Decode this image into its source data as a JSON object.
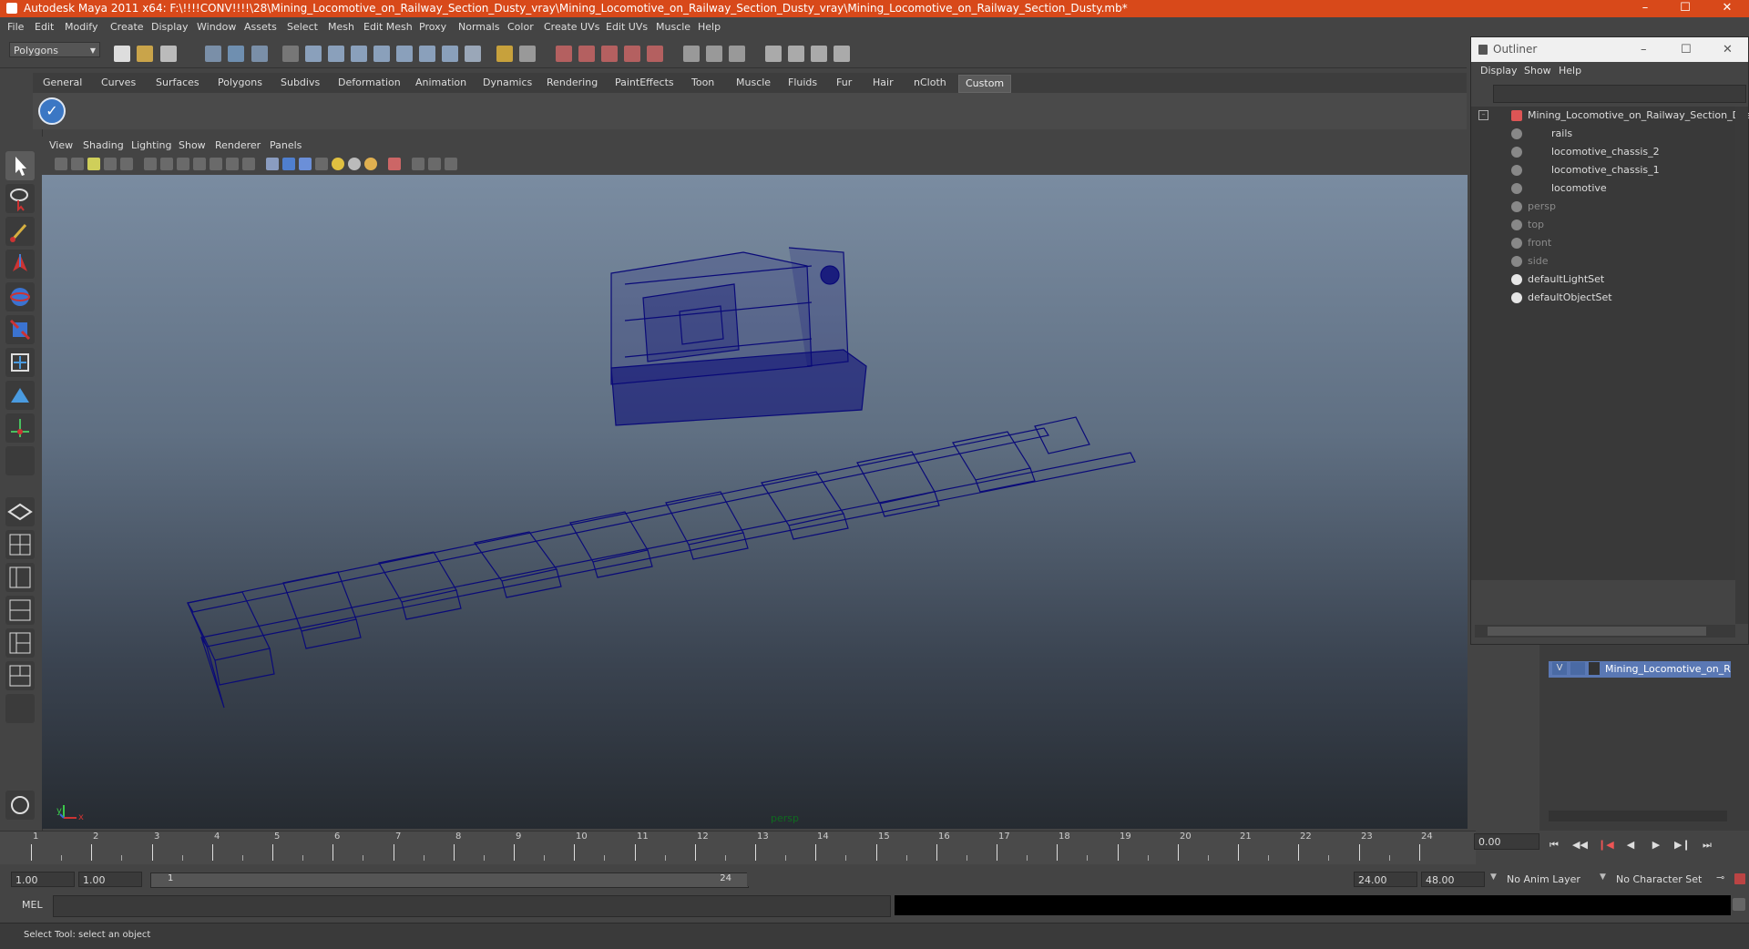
{
  "window": {
    "title": "Autodesk Maya 2011 x64: F:\\!!!!CONV!!!!\\28\\Mining_Locomotive_on_Railway_Section_Dusty_vray\\Mining_Locomotive_on_Railway_Section_Dusty_vray\\Mining_Locomotive_on_Railway_Section_Dusty.mb*"
  },
  "menubar": [
    "File",
    "Edit",
    "Modify",
    "Create",
    "Display",
    "Window",
    "Assets",
    "Select",
    "Mesh",
    "Edit Mesh",
    "Proxy",
    "Normals",
    "Color",
    "Create UVs",
    "Edit UVs",
    "Muscle",
    "Help"
  ],
  "status_line": {
    "mode": "Polygons"
  },
  "shelf_tabs": [
    {
      "label": "General"
    },
    {
      "label": "Curves"
    },
    {
      "label": "Surfaces"
    },
    {
      "label": "Polygons"
    },
    {
      "label": "Subdivs"
    },
    {
      "label": "Deformation"
    },
    {
      "label": "Animation"
    },
    {
      "label": "Dynamics"
    },
    {
      "label": "Rendering"
    },
    {
      "label": "PaintEffects"
    },
    {
      "label": "Toon"
    },
    {
      "label": "Muscle"
    },
    {
      "label": "Fluids"
    },
    {
      "label": "Fur"
    },
    {
      "label": "Hair"
    },
    {
      "label": "nCloth"
    },
    {
      "label": "Custom",
      "active": true
    }
  ],
  "panel_menu": [
    "View",
    "Shading",
    "Lighting",
    "Show",
    "Renderer",
    "Panels"
  ],
  "viewport": {
    "camera_label": "persp",
    "axis": {
      "x": "x",
      "y": "y"
    },
    "wire_color": "#0a0a78"
  },
  "timeline": {
    "ticks": [
      "1",
      "2",
      "3",
      "4",
      "5",
      "6",
      "7",
      "8",
      "9",
      "10",
      "11",
      "12",
      "13",
      "14",
      "15",
      "16",
      "17",
      "18",
      "19",
      "20",
      "21",
      "22",
      "23",
      "24"
    ],
    "current_time": "0.00"
  },
  "range": {
    "start": "1.00",
    "playback_start": "1.00",
    "slider_start": "1",
    "slider_end": "24",
    "playback_end": "24.00",
    "end": "48.00",
    "anim_layer": "No Anim Layer",
    "character_set": "No Character Set"
  },
  "command_line": {
    "label": "MEL"
  },
  "help_line": {
    "text": "Select Tool: select an object"
  },
  "outliner": {
    "title": "Outliner",
    "menu": [
      "Display",
      "Show",
      "Help"
    ],
    "items": [
      {
        "label": "Mining_Locomotive_on_Railway_Section_Dus",
        "indent": 0,
        "dim": false
      },
      {
        "label": "rails",
        "indent": 1,
        "dim": false
      },
      {
        "label": "locomotive_chassis_2",
        "indent": 1,
        "dim": false
      },
      {
        "label": "locomotive_chassis_1",
        "indent": 1,
        "dim": false
      },
      {
        "label": "locomotive",
        "indent": 1,
        "dim": false
      },
      {
        "label": "persp",
        "indent": 0,
        "dim": true
      },
      {
        "label": "top",
        "indent": 0,
        "dim": true
      },
      {
        "label": "front",
        "indent": 0,
        "dim": true
      },
      {
        "label": "side",
        "indent": 0,
        "dim": true
      },
      {
        "label": "defaultLightSet",
        "indent": 0,
        "dim": false
      },
      {
        "label": "defaultObjectSet",
        "indent": 0,
        "dim": false
      }
    ]
  },
  "layer_panel": {
    "visibility": "V",
    "layer_name": "Mining_Locomotive_on_R"
  },
  "colors": {
    "title_bar": "#d8491a",
    "selection": "#5a78b4"
  }
}
